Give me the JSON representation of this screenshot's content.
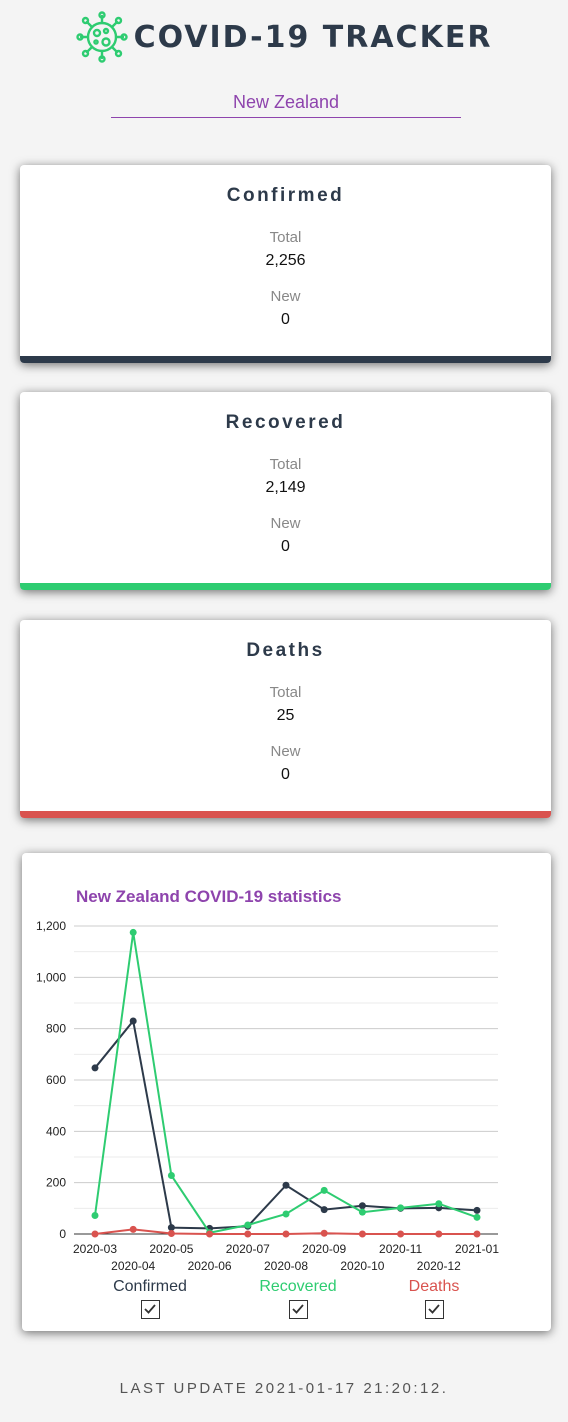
{
  "header": {
    "title": "COVID-19 TRACKER",
    "logo_icon": "virus-icon"
  },
  "country_select": {
    "value": "New Zealand"
  },
  "cards": [
    {
      "title": "Confirmed",
      "total_label": "Total",
      "total": "2,256",
      "new_label": "New",
      "new": "0",
      "color": "#2d3a4a"
    },
    {
      "title": "Recovered",
      "total_label": "Total",
      "total": "2,149",
      "new_label": "New",
      "new": "0",
      "color": "#2ecc71"
    },
    {
      "title": "Deaths",
      "total_label": "Total",
      "total": "25",
      "new_label": "New",
      "new": "0",
      "color": "#d9534f"
    }
  ],
  "chart": {
    "title": "New Zealand COVID-19 statistics"
  },
  "chart_data": {
    "type": "line",
    "title": "New Zealand COVID-19 statistics",
    "x": [
      "2020-03",
      "2020-04",
      "2020-05",
      "2020-06",
      "2020-07",
      "2020-08",
      "2020-09",
      "2020-10",
      "2020-11",
      "2020-12",
      "2021-01"
    ],
    "ylim": [
      0,
      1200
    ],
    "yticks": [
      0,
      200,
      400,
      600,
      800,
      1000,
      1200
    ],
    "ytick_labels": [
      "0",
      "200",
      "400",
      "600",
      "800",
      "1,000",
      "1,200"
    ],
    "grid": true,
    "legend": "bottom",
    "series": [
      {
        "name": "Confirmed",
        "color": "#2d3a4a",
        "values": [
          647,
          830,
          25,
          22,
          30,
          190,
          95,
          110,
          100,
          102,
          92
        ]
      },
      {
        "name": "Recovered",
        "color": "#2ecc71",
        "values": [
          72,
          1175,
          228,
          5,
          35,
          78,
          170,
          85,
          102,
          118,
          65
        ]
      },
      {
        "name": "Deaths",
        "color": "#d9534f",
        "values": [
          0,
          18,
          2,
          0,
          0,
          0,
          3,
          0,
          0,
          0,
          0
        ]
      }
    ]
  },
  "footer": {
    "text": "LAST UPDATE 2021-01-17 21:20:12."
  }
}
